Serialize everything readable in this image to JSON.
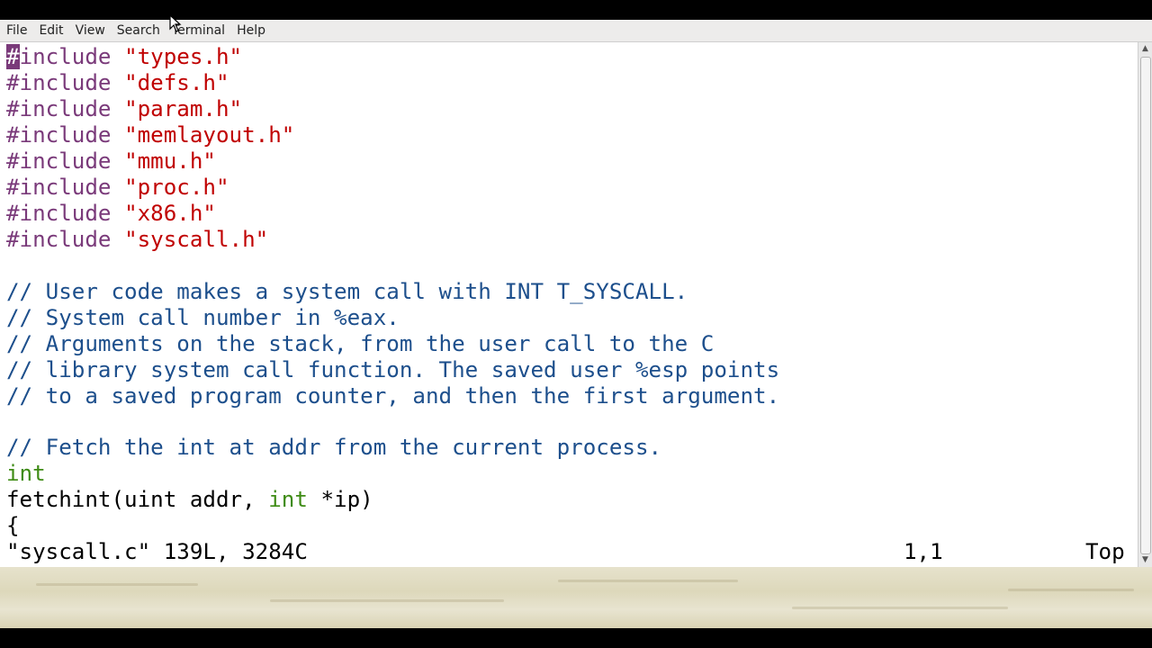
{
  "menubar": {
    "items": [
      "File",
      "Edit",
      "View",
      "Search",
      "Terminal",
      "Help"
    ]
  },
  "editor": {
    "includes": [
      "\"types.h\"",
      "\"defs.h\"",
      "\"param.h\"",
      "\"memlayout.h\"",
      "\"mmu.h\"",
      "\"proc.h\"",
      "\"x86.h\"",
      "\"syscall.h\""
    ],
    "include_first_char": "#",
    "include_rest": "include ",
    "include_directive": "#include ",
    "comments": [
      "// User code makes a system call with INT T_SYSCALL.",
      "// System call number in %eax.",
      "// Arguments on the stack, from the user call to the C",
      "// library system call function. The saved user %esp points",
      "// to a saved program counter, and then the first argument."
    ],
    "fetch_comment": "// Fetch the int at addr from the current process.",
    "return_type": "int",
    "func_name_part": "fetchint(uint addr, ",
    "param_type": "int",
    "param_rest": " *ip)",
    "brace": "{"
  },
  "status": {
    "file_info": "\"syscall.c\" 139L, 3284C",
    "position": "1,1",
    "scroll": "Top"
  },
  "colors": {
    "preprocessor": "#7a3a7a",
    "string": "#c00000",
    "comment": "#1d4f8c",
    "type": "#3e8b14"
  }
}
